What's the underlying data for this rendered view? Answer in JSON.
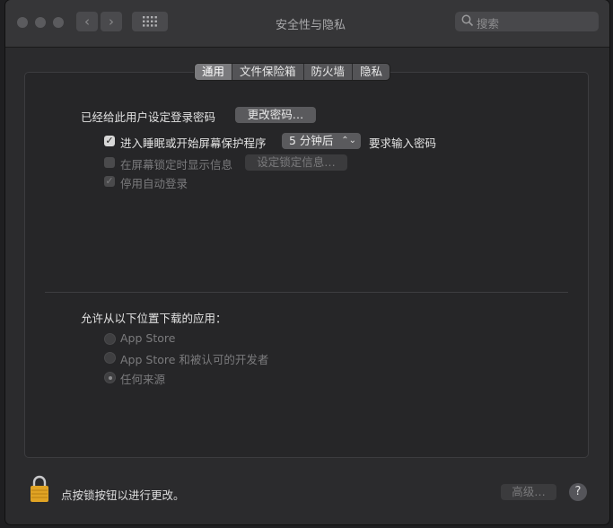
{
  "window": {
    "title": "安全性与隐私",
    "search_placeholder": "搜索"
  },
  "tabs": [
    {
      "label": "通用",
      "active": true
    },
    {
      "label": "文件保险箱",
      "active": false
    },
    {
      "label": "防火墙",
      "active": false
    },
    {
      "label": "隐私",
      "active": false
    }
  ],
  "general": {
    "password_label": "已经给此用户设定登录密码",
    "change_password_button": "更改密码…",
    "require_password": {
      "checked": true,
      "label_prefix": "进入睡眠或开始屏幕保护程序",
      "delay_value": "5 分钟后",
      "label_suffix": "要求输入密码"
    },
    "lock_message": {
      "checked": false,
      "label": "在屏幕锁定时显示信息",
      "button": "设定锁定信息…"
    },
    "disable_auto_login": {
      "checked": true,
      "label": "停用自动登录"
    }
  },
  "downloads": {
    "heading": "允许从以下位置下载的应用：",
    "options": [
      {
        "label": "App Store",
        "selected": false
      },
      {
        "label": "App Store 和被认可的开发者",
        "selected": false
      },
      {
        "label": "任何来源",
        "selected": true
      }
    ]
  },
  "footer": {
    "lock_text": "点按锁按钮以进行更改。",
    "advanced_button": "高级…",
    "help_label": "?"
  },
  "colors": {
    "window_bg": "#2b2b2d",
    "panel_bg": "#262628",
    "lock_gold": "#e0a324"
  }
}
